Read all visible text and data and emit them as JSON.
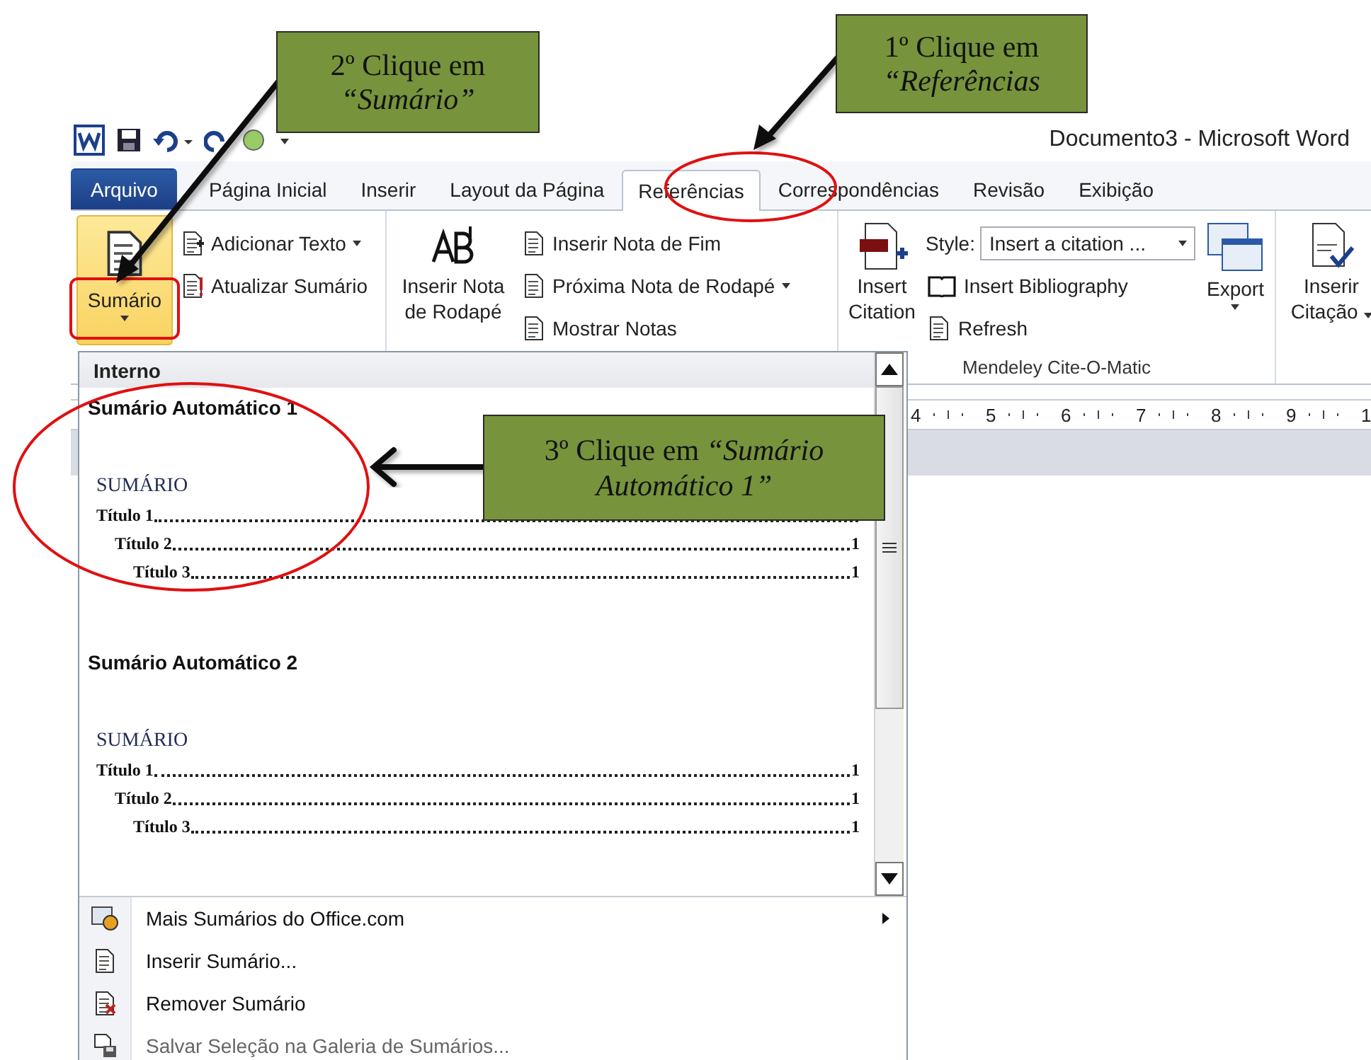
{
  "callouts": [
    {
      "kind": "toc",
      "text": "2º Clique em *“Sumário”*"
    },
    {
      "kind": "references",
      "text": "1º Clique em *“Referências*"
    },
    {
      "kind": "auto",
      "text": "3º Clique em *“Sumário Automático 1”*"
    }
  ],
  "window": {
    "title": "Documento3  -  Microsoft Word"
  },
  "tabs": [
    {
      "label": "Arquivo",
      "kind": "file",
      "selected": false
    },
    {
      "label": "Página Inicial",
      "kind": "tab",
      "selected": false
    },
    {
      "label": "Inserir",
      "kind": "tab",
      "selected": false
    },
    {
      "label": "Layout da Página",
      "kind": "tab",
      "selected": false
    },
    {
      "label": "Referências",
      "kind": "tab",
      "selected": true
    },
    {
      "label": "Correspondências",
      "kind": "tab",
      "selected": false
    },
    {
      "label": "Revisão",
      "kind": "tab",
      "selected": false
    },
    {
      "label": "Exibição",
      "kind": "tab",
      "selected": false
    }
  ],
  "ribbon": {
    "toc_group": {
      "button": {
        "label": "Sumário",
        "pressed": true
      },
      "items": [
        {
          "label": "Adicionar Texto",
          "dropdown": true
        },
        {
          "label": "Atualizar Sumário",
          "dropdown": false
        }
      ]
    },
    "notes_group": {
      "button": {
        "label": "Inserir Nota de Rodapé"
      },
      "items": [
        {
          "label": "Inserir Nota de Fim",
          "dropdown": false
        },
        {
          "label": "Próxima Nota de Rodapé",
          "dropdown": true
        },
        {
          "label": "Mostrar Notas",
          "dropdown": false
        }
      ]
    },
    "mendeley_group": {
      "label": "Mendeley Cite-O-Matic",
      "insert_button": "Insert Citation",
      "style_label": "Style:",
      "style_value": "Insert a citation ...",
      "items": [
        "Insert Bibliography",
        "Refresh"
      ],
      "export_button": "Export"
    },
    "citation_button": {
      "label": "Inserir Citação"
    }
  },
  "ruler": {
    "numbers": [
      "4",
      "5",
      "6",
      "7",
      "8",
      "9",
      "1"
    ]
  },
  "gallery": {
    "header": "Interno",
    "items": [
      {
        "title": "Sumário Automático 1",
        "preview": {
          "heading": "SUMÁRIO",
          "entries": [
            {
              "text": "Título 1",
              "children": [
                {
                  "text": "Título 2",
                  "page": "1",
                  "children": [
                    {
                      "text": "Título 3",
                      "page": "1"
                    }
                  ]
                }
              ]
            }
          ]
        }
      },
      {
        "title": "Sumário Automático 2",
        "preview": {
          "heading": "SUMÁRIO",
          "entries": [
            {
              "text": "Título 1",
              "page": "1",
              "children": [
                {
                  "text": "Título 2",
                  "page": "1",
                  "children": [
                    {
                      "text": "Título 3",
                      "page": "1"
                    }
                  ]
                }
              ]
            }
          ]
        }
      }
    ]
  },
  "menu": [
    {
      "label": "Mais Sumários do Office.com",
      "kind": "web",
      "submenu": true,
      "disabled": false
    },
    {
      "label": "Inserir Sumário...",
      "kind": "insert",
      "submenu": false,
      "disabled": false
    },
    {
      "label": "Remover Sumário",
      "kind": "remove",
      "submenu": false,
      "disabled": false
    },
    {
      "label": "Salvar Seleção na Galeria de Sumários...",
      "kind": "save",
      "submenu": false,
      "disabled": true
    }
  ]
}
